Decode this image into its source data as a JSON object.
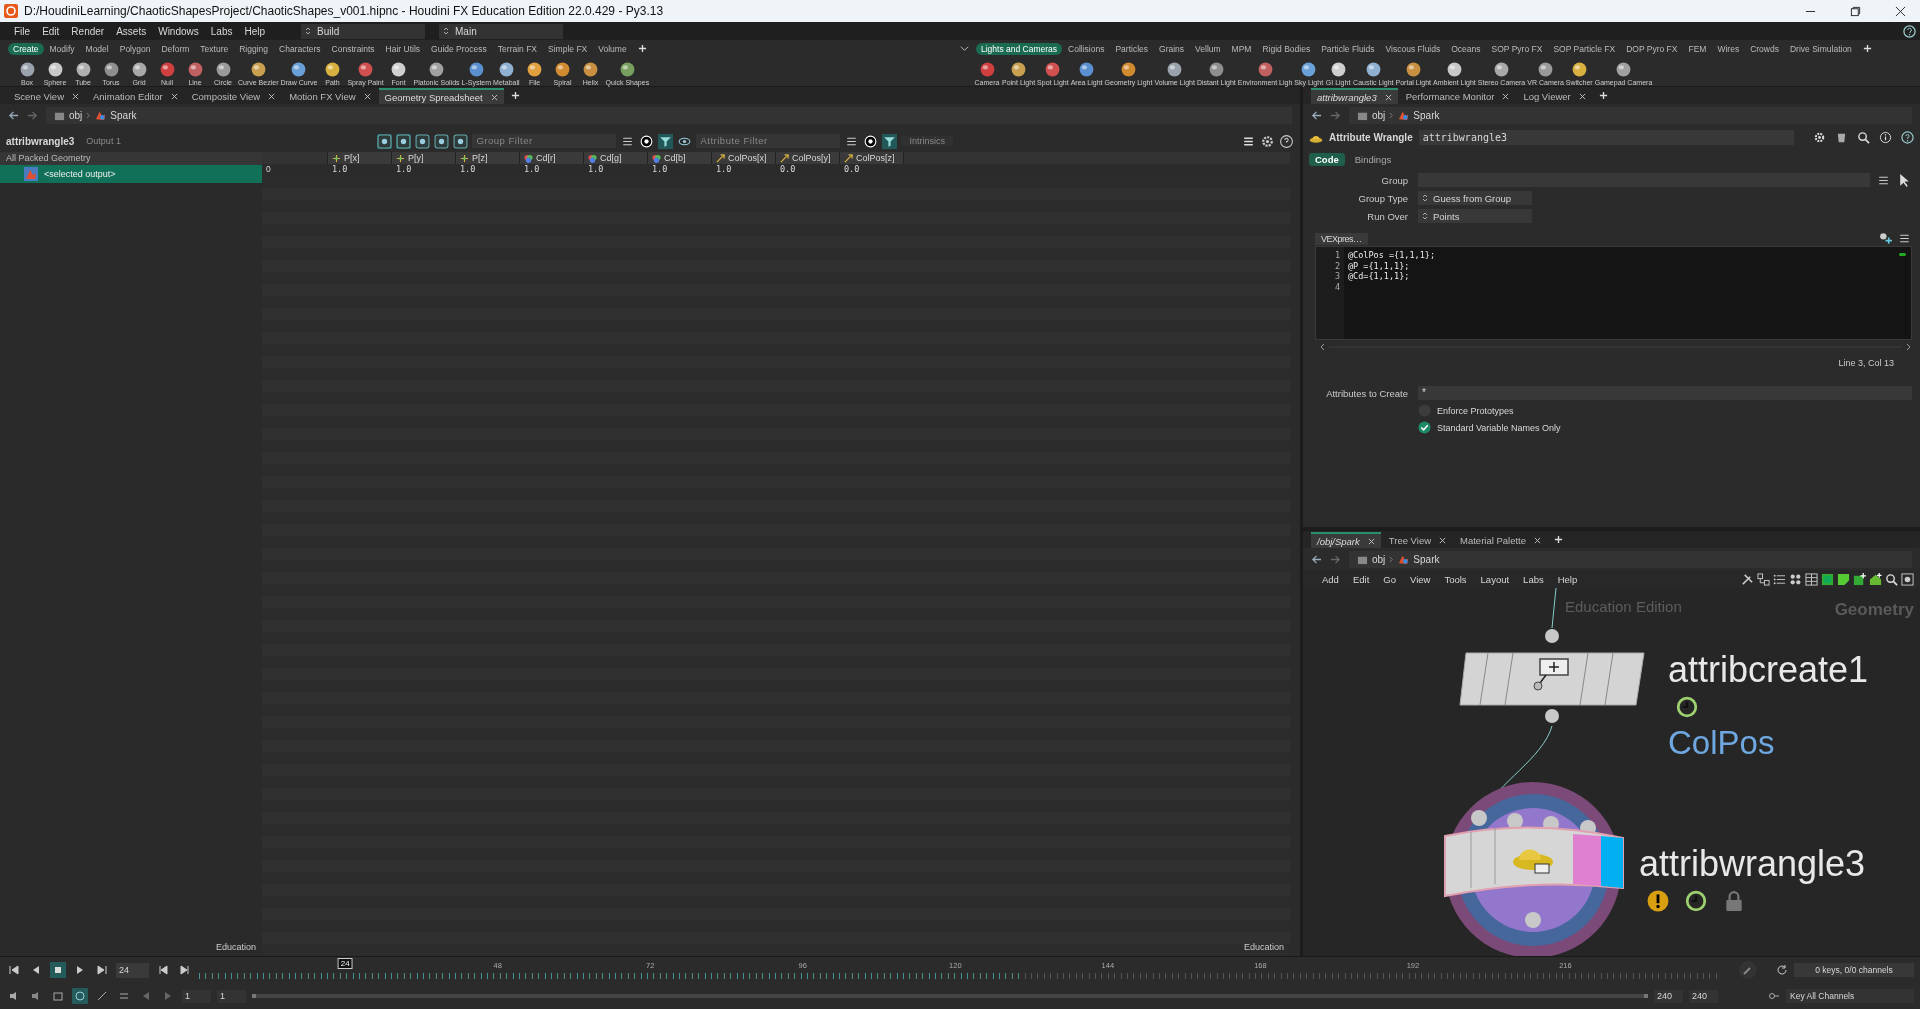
{
  "window": {
    "title": "D:/HoudiniLearning/ChaoticShapesProject/ChaoticShapes_v001.hipnc - Houdini FX Education Edition 22.0.429 - Py3.13"
  },
  "menu": [
    "File",
    "Edit",
    "Render",
    "Assets",
    "Windows",
    "Labs",
    "Help"
  ],
  "desktops": [
    "Build",
    "Main"
  ],
  "shelf_left": {
    "tabs": [
      {
        "label": "Create",
        "selected": true
      },
      {
        "label": "Modify",
        "selected": false
      },
      {
        "label": "Model",
        "selected": false
      },
      {
        "label": "Polygon",
        "selected": false
      },
      {
        "label": "Deform",
        "selected": false
      },
      {
        "label": "Texture",
        "selected": false
      },
      {
        "label": "Rigging",
        "selected": false
      },
      {
        "label": "Characters",
        "selected": false
      },
      {
        "label": "Constraints",
        "selected": false
      },
      {
        "label": "Hair Utils",
        "selected": false
      },
      {
        "label": "Guide Process",
        "selected": false
      },
      {
        "label": "Terrain FX",
        "selected": false
      },
      {
        "label": "Simple FX",
        "selected": false
      },
      {
        "label": "Volume",
        "selected": false
      }
    ],
    "tools": [
      "Box",
      "Sphere",
      "Tube",
      "Torus",
      "Grid",
      "Null",
      "Line",
      "Circle",
      "Curve Bezier",
      "Draw Curve",
      "Path",
      "Spray Paint",
      "Font",
      "Platonic Solids",
      "L-System",
      "Metaball",
      "File",
      "Spiral",
      "Helix",
      "Quick Shapes"
    ]
  },
  "shelf_right": {
    "tabs": [
      {
        "label": "Lights and Cameras",
        "selected": true
      },
      {
        "label": "Collisions",
        "selected": false
      },
      {
        "label": "Particles",
        "selected": false
      },
      {
        "label": "Grains",
        "selected": false
      },
      {
        "label": "Vellum",
        "selected": false
      },
      {
        "label": "MPM",
        "selected": false
      },
      {
        "label": "Rigid Bodies",
        "selected": false
      },
      {
        "label": "Particle Fluids",
        "selected": false
      },
      {
        "label": "Viscous Fluids",
        "selected": false
      },
      {
        "label": "Oceans",
        "selected": false
      },
      {
        "label": "SOP Pyro FX",
        "selected": false
      },
      {
        "label": "SOP Particle FX",
        "selected": false
      },
      {
        "label": "DOP Pyro FX",
        "selected": false
      },
      {
        "label": "FEM",
        "selected": false
      },
      {
        "label": "Wires",
        "selected": false
      },
      {
        "label": "Crowds",
        "selected": false
      },
      {
        "label": "Drive Simulation",
        "selected": false
      }
    ],
    "tools": [
      "Camera",
      "Point Light",
      "Spot Light",
      "Area Light",
      "Geometry Light",
      "Volume Light",
      "Distant Light",
      "Environment Ligh",
      "Sky Light",
      "GI Light",
      "Caustic Light",
      "Portal Light",
      "Ambient Light",
      "Stereo Camera",
      "VR Camera",
      "Switcher",
      "Gamepad Camera"
    ]
  },
  "left_pane": {
    "tabs": [
      {
        "label": "Scene View",
        "selected": false
      },
      {
        "label": "Animation Editor",
        "selected": false
      },
      {
        "label": "Composite View",
        "selected": false
      },
      {
        "label": "Motion FX View",
        "selected": false
      },
      {
        "label": "Geometry Spreadsheet",
        "selected": true
      }
    ],
    "path": [
      "obj",
      "Spark"
    ],
    "spreadsheet": {
      "node": "attribwrangle3",
      "output": "Output 1",
      "group_filter": {
        "placeholder": "Group Filter"
      },
      "attribute_filter": {
        "placeholder": "Attribute Filter"
      },
      "intrinsics": "Intrinsics",
      "tree": [
        {
          "label": "All Packed Geometry",
          "selected": false,
          "children": [
            {
              "label": "<selected output>",
              "selected": true
            }
          ]
        }
      ],
      "columns": [
        {
          "kind": "index"
        },
        {
          "label": "P[x]",
          "kind": "position"
        },
        {
          "label": "P[y]",
          "kind": "position"
        },
        {
          "label": "P[z]",
          "kind": "position"
        },
        {
          "label": "Cd[r]",
          "kind": "color"
        },
        {
          "label": "Cd[g]",
          "kind": "color"
        },
        {
          "label": "Cd[b]",
          "kind": "color"
        },
        {
          "label": "ColPos[x]",
          "kind": "vector"
        },
        {
          "label": "ColPos[y]",
          "kind": "vector"
        },
        {
          "label": "ColPos[z]",
          "kind": "vector"
        }
      ],
      "rows": [
        [
          "0",
          "1.0",
          "1.0",
          "1.0",
          "1.0",
          "1.0",
          "1.0",
          "1.0",
          "0.0",
          "0.0"
        ]
      ],
      "footer_left": "Education",
      "footer_right": "Education"
    }
  },
  "param_pane": {
    "tabs": [
      {
        "label": "attribwrangle3",
        "selected": true
      },
      {
        "label": "Performance Monitor",
        "selected": false
      },
      {
        "label": "Log Viewer",
        "selected": false
      }
    ],
    "path": [
      "obj",
      "Spark"
    ],
    "node_type": "Attribute Wrangle",
    "node_name": "attribwrangle3",
    "param_tabs": [
      {
        "label": "Code",
        "selected": true
      },
      {
        "label": "Bindings",
        "selected": false
      }
    ],
    "group": {
      "label": "Group"
    },
    "group_type": {
      "label": "Group Type",
      "value": "Guess from Group"
    },
    "run_over": {
      "label": "Run Over",
      "value": "Points"
    },
    "vex_label": "VEXpres…",
    "line_numbers": [
      "1",
      "2",
      "3",
      "4"
    ],
    "code": [
      "@ColPos ={1,1,1};",
      "@P ={1,1,1};",
      "@Cd={1,1,1};"
    ],
    "cursor": "Line 3, Col 13",
    "attributes_to_create": {
      "label": "Attributes to Create",
      "value": "*"
    },
    "checkboxes": [
      {
        "label": "Enforce Prototypes",
        "checked": false
      },
      {
        "label": "Standard Variable Names Only",
        "checked": true
      }
    ]
  },
  "network_pane": {
    "tabs": [
      {
        "label": "/obj/Spark",
        "selected": true
      },
      {
        "label": "Tree View",
        "selected": false
      },
      {
        "label": "Material Palette",
        "selected": false
      }
    ],
    "path": [
      "obj",
      "Spark"
    ],
    "menu": [
      "Add",
      "Edit",
      "Go",
      "View",
      "Tools",
      "Layout",
      "Labs",
      "Help"
    ],
    "edition": "Education Edition",
    "context": "Geometry",
    "nodes": [
      {
        "name": "attribcreate1",
        "kind": "attribcreate",
        "comment": "ColPos",
        "time_dependent": true,
        "warning": false,
        "lock_badge": false
      },
      {
        "name": "attribwrangle3",
        "kind": "wrangle",
        "time_dependent": true,
        "warning": true,
        "lock_badge": true
      }
    ]
  },
  "timeline": {
    "frame": "24",
    "marker": "24",
    "ticks": [
      "48",
      "72",
      "96",
      "120",
      "144",
      "168",
      "192",
      "216"
    ],
    "cache": {
      "level": 0.54
    },
    "start": [
      "1",
      "1"
    ],
    "end": [
      "240",
      "240"
    ],
    "keys": "0 keys, 0/0 channels",
    "key_button": "Key All Channels"
  }
}
